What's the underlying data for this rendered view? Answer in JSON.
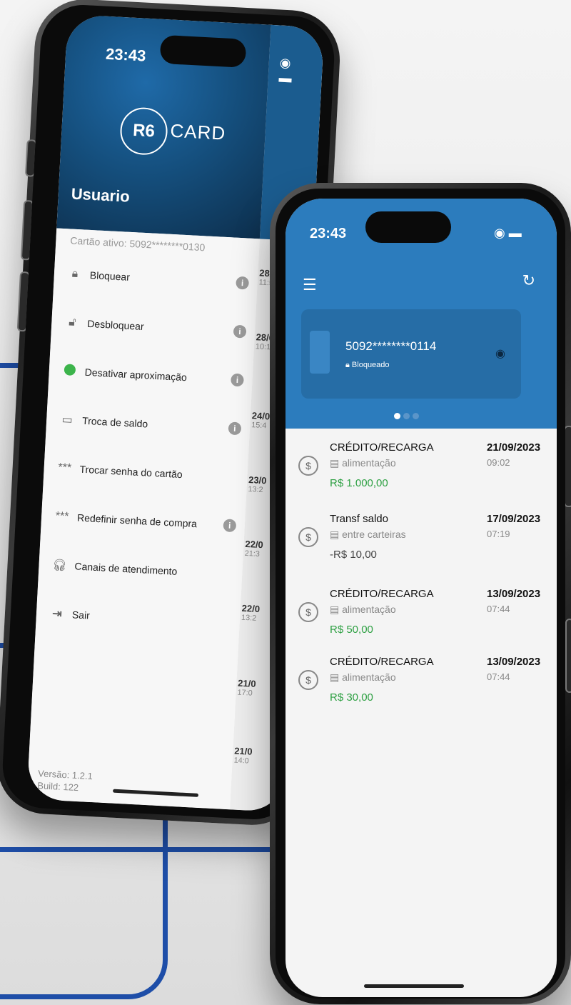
{
  "colors": {
    "brand_blue": "#2c7cbd",
    "positive": "#2ea043",
    "accent_line": "#1e4ea8"
  },
  "drawer_phone": {
    "status_time": "23:43",
    "logo_mark": "R6",
    "logo_text": "CARD",
    "user_name": "Usuario",
    "active_card": "Cartão ativo: 5092********0130",
    "menu": [
      {
        "label": "Bloquear",
        "icon": "lock-icon",
        "has_info": true
      },
      {
        "label": "Desbloquear",
        "icon": "unlock-icon",
        "has_info": true
      },
      {
        "label": "Desativar aproximação",
        "icon": "contactless-toggle-icon",
        "has_info": true
      },
      {
        "label": "Troca de saldo",
        "icon": "card-swap-icon",
        "has_info": true
      },
      {
        "label": "Trocar senha do cartão",
        "icon": "password-icon",
        "has_info": false
      },
      {
        "label": "Redefinir senha de compra",
        "icon": "password-icon",
        "has_info": true
      },
      {
        "label": "Canais de atendimento",
        "icon": "headset-icon",
        "has_info": false
      },
      {
        "label": "Sair",
        "icon": "exit-icon",
        "has_info": false
      }
    ],
    "version": "Versão: 1.2.1",
    "build": "Build: 122",
    "peek_dates": [
      {
        "d": "28/0",
        "t": "11:5"
      },
      {
        "d": "28/0",
        "t": "10:1"
      },
      {
        "d": "24/0",
        "t": "15:4"
      },
      {
        "d": "23/0",
        "t": "13:2"
      },
      {
        "d": "22/0",
        "t": "21:3"
      },
      {
        "d": "22/0",
        "t": "13:2"
      },
      {
        "d": "21/0",
        "t": "17:0"
      },
      {
        "d": "21/0",
        "t": "14:0"
      }
    ]
  },
  "main_phone": {
    "status_time": "23:43",
    "card_number": "5092********0114",
    "card_status": "Bloqueado",
    "transactions": [
      {
        "title": "CRÉDITO/RECARGA",
        "category": "alimentação",
        "amount": "R$ 1.000,00",
        "date": "21/09/2023",
        "time": "09:02",
        "positive": true
      },
      {
        "title": "Transf saldo",
        "category": "entre carteiras",
        "amount": "-R$ 10,00",
        "date": "17/09/2023",
        "time": "07:19",
        "positive": false
      },
      {
        "title": "CRÉDITO/RECARGA",
        "category": "alimentação",
        "amount": "R$ 50,00",
        "date": "13/09/2023",
        "time": "07:44",
        "positive": true
      },
      {
        "title": "CRÉDITO/RECARGA",
        "category": "alimentação",
        "amount": "R$ 30,00",
        "date": "13/09/2023",
        "time": "07:44",
        "positive": true
      }
    ]
  }
}
